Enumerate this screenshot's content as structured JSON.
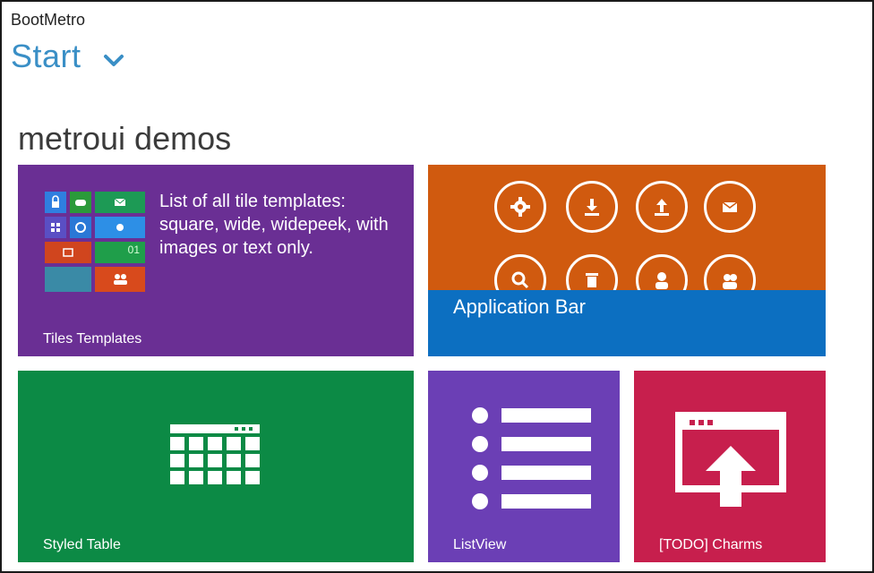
{
  "app": {
    "brand": "BootMetro",
    "start_title": "Start"
  },
  "group": {
    "title": "metroui demos"
  },
  "tiles": [
    {
      "id": "templates",
      "label": "Tiles Templates",
      "description": "List of all tile templates: square, wide, widepeek, with images or text only.",
      "color": "#6a2f94"
    },
    {
      "id": "appbar",
      "label": "Application Bar",
      "color": "#d05a0f",
      "strip_color": "#0c6fc1"
    },
    {
      "id": "table",
      "label": "Styled Table",
      "color": "#0c8a45"
    },
    {
      "id": "listview",
      "label": "ListView",
      "color": "#6b3fb5"
    },
    {
      "id": "charms",
      "label": "[TODO] Charms",
      "color": "#c71f4d"
    }
  ],
  "appbar_icons": [
    "settings-icon",
    "download-icon",
    "upload-icon",
    "mail-icon",
    "search-icon",
    "trash-icon",
    "user-icon",
    "users-icon"
  ],
  "mini_tiles": {
    "time": "01"
  }
}
